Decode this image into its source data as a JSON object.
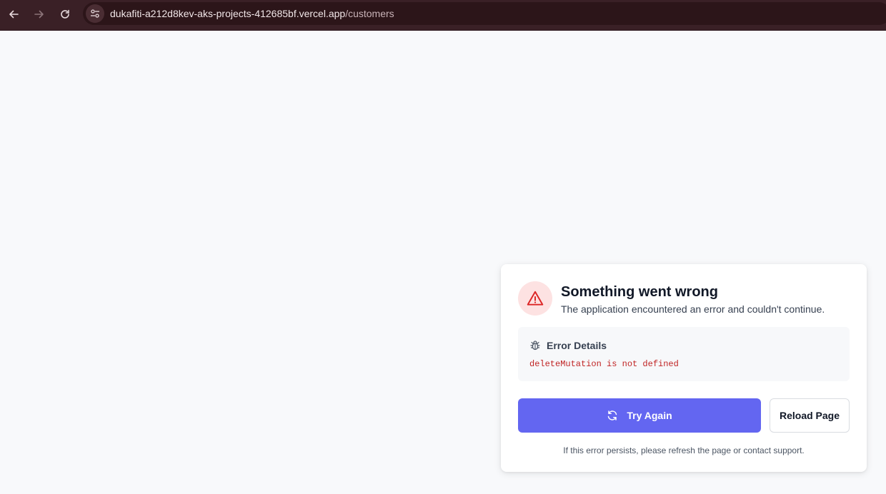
{
  "browser": {
    "url_host": "dukafiti-a212d8kev-aks-projects-412685bf.vercel.app",
    "url_path": "/customers"
  },
  "error_card": {
    "title": "Something went wrong",
    "subtitle": "The application encountered an error and couldn't continue.",
    "details_title": "Error Details",
    "error_message": "deleteMutation is not defined",
    "try_again_label": "Try Again",
    "reload_label": "Reload Page",
    "footnote": "If this error persists, please refresh the page or contact support."
  },
  "icons": {
    "back": "arrow-left-icon",
    "forward": "arrow-right-icon",
    "reload": "reload-icon",
    "site_info": "tune-icon",
    "warning": "warning-triangle-icon",
    "bug": "bug-icon",
    "refresh": "refresh-cycle-icon"
  },
  "colors": {
    "accent": "#6366f1",
    "error_text": "#c02424",
    "warning_bg": "#fde2e2",
    "warning_icon": "#dc2626",
    "browser_bar": "#3a2026"
  }
}
